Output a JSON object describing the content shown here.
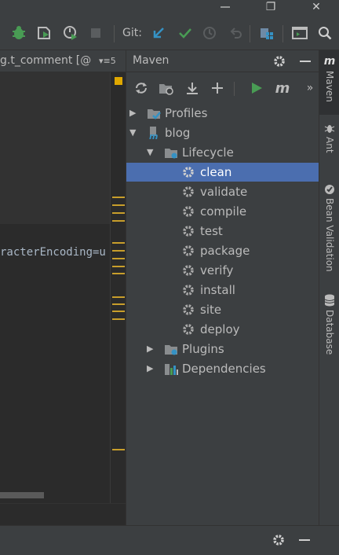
{
  "window": {
    "restore_glyph": "❐",
    "close_glyph": "✕"
  },
  "toolbar": {
    "git_label": "Git:",
    "icons": [
      "debug-icon",
      "run-with-coverage-icon",
      "profile-icon",
      "stop-icon",
      "git-update-icon",
      "git-commit-icon",
      "git-history-icon",
      "git-rollback-icon",
      "project-structure-icon",
      "terminal-icon",
      "search-icon"
    ]
  },
  "editor": {
    "tab_label": "g.t_comment [@",
    "tab_overflow": "▾≡5",
    "code_line": "racterEncoding=u"
  },
  "maven": {
    "title": "Maven",
    "toolbar_more": "»",
    "m_label": "m",
    "tree": [
      {
        "label": "Profiles",
        "depth": 0,
        "expanded": false,
        "icon": "profiles-folder-icon"
      },
      {
        "label": "blog",
        "depth": 0,
        "expanded": true,
        "icon": "maven-module-icon"
      },
      {
        "label": "Lifecycle",
        "depth": 1,
        "expanded": true,
        "icon": "lifecycle-folder-icon"
      },
      {
        "label": "clean",
        "depth": 2,
        "selected": true,
        "icon": "gear-icon"
      },
      {
        "label": "validate",
        "depth": 2,
        "icon": "gear-icon"
      },
      {
        "label": "compile",
        "depth": 2,
        "icon": "gear-icon"
      },
      {
        "label": "test",
        "depth": 2,
        "icon": "gear-icon"
      },
      {
        "label": "package",
        "depth": 2,
        "icon": "gear-icon"
      },
      {
        "label": "verify",
        "depth": 2,
        "icon": "gear-icon"
      },
      {
        "label": "install",
        "depth": 2,
        "icon": "gear-icon"
      },
      {
        "label": "site",
        "depth": 2,
        "icon": "gear-icon"
      },
      {
        "label": "deploy",
        "depth": 2,
        "icon": "gear-icon"
      },
      {
        "label": "Plugins",
        "depth": 1,
        "expanded": false,
        "icon": "plugins-folder-icon"
      },
      {
        "label": "Dependencies",
        "depth": 1,
        "expanded": false,
        "icon": "dependencies-icon"
      }
    ]
  },
  "stripe": {
    "items": [
      {
        "label": "Maven",
        "icon": "maven-icon",
        "active": true
      },
      {
        "label": "Ant",
        "icon": "ant-icon"
      },
      {
        "label": "Bean Validation",
        "icon": "bean-validation-icon"
      },
      {
        "label": "Database",
        "icon": "database-icon"
      }
    ]
  },
  "colors": {
    "accent_selection": "#4b6eaf",
    "run_green": "#499c54",
    "git_blue": "#3592c4",
    "warning_yellow": "#e0a800"
  }
}
